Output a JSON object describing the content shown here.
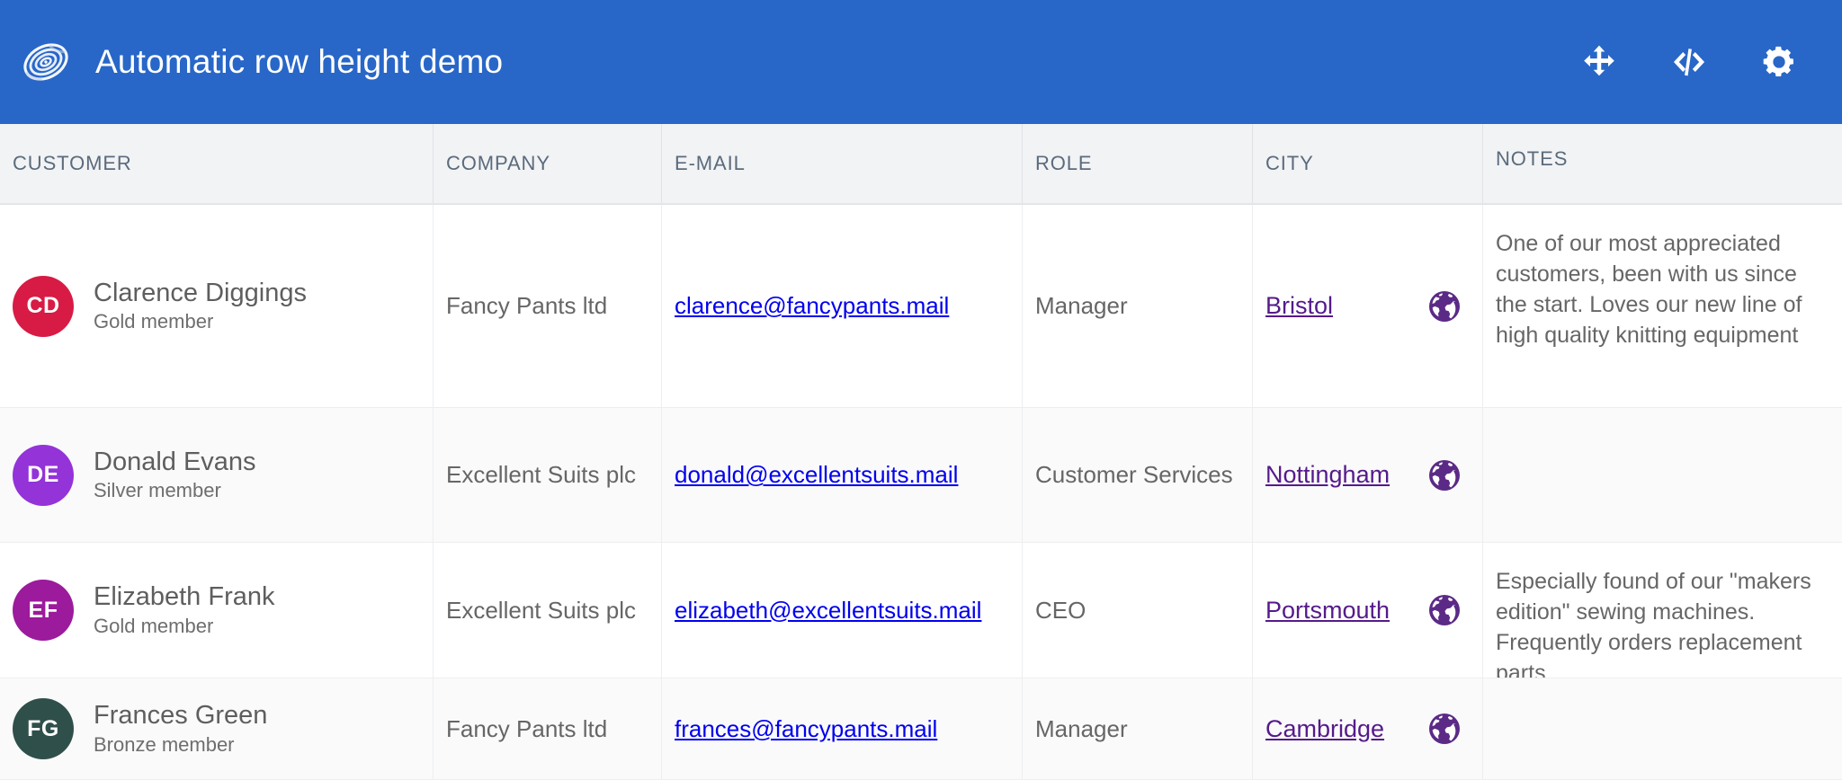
{
  "app": {
    "title": "Automatic row height demo",
    "bar_color": "#2867c8",
    "logo_icon": "spiral-galaxy-logo"
  },
  "toolbar": {
    "buttons": [
      {
        "name": "move-button",
        "icon": "arrows-move-icon",
        "label": "Move"
      },
      {
        "name": "code-button",
        "icon": "code-brackets-icon",
        "label": "View source"
      },
      {
        "name": "settings-button",
        "icon": "gear-icon",
        "label": "Settings"
      }
    ]
  },
  "grid": {
    "columns": [
      {
        "key": "customer",
        "label": "CUSTOMER"
      },
      {
        "key": "company",
        "label": "COMPANY"
      },
      {
        "key": "email",
        "label": "E-MAIL"
      },
      {
        "key": "role",
        "label": "ROLE"
      },
      {
        "key": "city",
        "label": "CITY"
      },
      {
        "key": "notes",
        "label": "NOTES"
      }
    ],
    "link_colors": {
      "email": "#0000ee",
      "city": "#551a8b"
    },
    "globe_icon": "globe-icon",
    "rows": [
      {
        "initials": "CD",
        "avatar_color": "#d81b44",
        "name": "Clarence Diggings",
        "membership": "Gold member",
        "company": "Fancy Pants ltd",
        "email": "clarence@fancypants.mail",
        "role": "Manager",
        "city": "Bristol",
        "notes": "One of our most appreciated customers, been with us since the start. Loves our new line of high quality knitting equipment"
      },
      {
        "initials": "DE",
        "avatar_color": "#9333d8",
        "name": "Donald Evans",
        "membership": "Silver member",
        "company": "Excellent Suits plc",
        "email": "donald@excellentsuits.mail",
        "role": "Customer Services",
        "city": "Nottingham",
        "notes": ""
      },
      {
        "initials": "EF",
        "avatar_color": "#9c1a9c",
        "name": "Elizabeth Frank",
        "membership": "Gold member",
        "company": "Excellent Suits plc",
        "email": "elizabeth@excellentsuits.mail",
        "role": "CEO",
        "city": "Portsmouth",
        "notes": "Especially found of our \"makers edition\" sewing machines. Frequently orders replacement parts"
      },
      {
        "initials": "FG",
        "avatar_color": "#2f4f4a",
        "name": "Frances Green",
        "membership": "Bronze member",
        "company": "Fancy Pants ltd",
        "email": "frances@fancypants.mail",
        "role": "Manager",
        "city": "Cambridge",
        "notes": ""
      }
    ]
  }
}
